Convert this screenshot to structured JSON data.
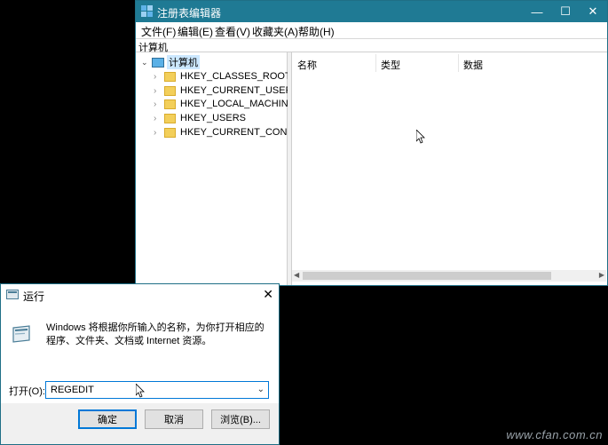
{
  "regedit": {
    "title": "注册表编辑器",
    "menu": [
      "文件(F)",
      "编辑(E)",
      "查看(V)",
      "收藏夹(A)",
      "帮助(H)"
    ],
    "address": "计算机",
    "tree": {
      "root": "计算机",
      "items": [
        "HKEY_CLASSES_ROOT",
        "HKEY_CURRENT_USER",
        "HKEY_LOCAL_MACHINE",
        "HKEY_USERS",
        "HKEY_CURRENT_CONFIG"
      ]
    },
    "columns": [
      "名称",
      "类型",
      "数据"
    ],
    "controls": {
      "minimize": "—",
      "maximize": "☐",
      "close": "✕"
    }
  },
  "run": {
    "title": "运行",
    "close": "✕",
    "description": "Windows 将根据你所输入的名称，为你打开相应的程序、文件夹、文档或 Internet 资源。",
    "open_label": "打开(O):",
    "input_value": "REGEDIT",
    "buttons": {
      "ok": "确定",
      "cancel": "取消",
      "browse": "浏览(B)..."
    }
  },
  "watermark": "www.cfan.com.cn",
  "colors": {
    "titlebar": "#1f7a94",
    "selection": "#cce8ff",
    "accent": "#0078d7"
  },
  "icons": [
    "regedit-icon",
    "computer-icon",
    "folder-icon",
    "run-icon",
    "chevron-down-icon",
    "chevron-right-icon",
    "mouse-pointer-icon"
  ]
}
